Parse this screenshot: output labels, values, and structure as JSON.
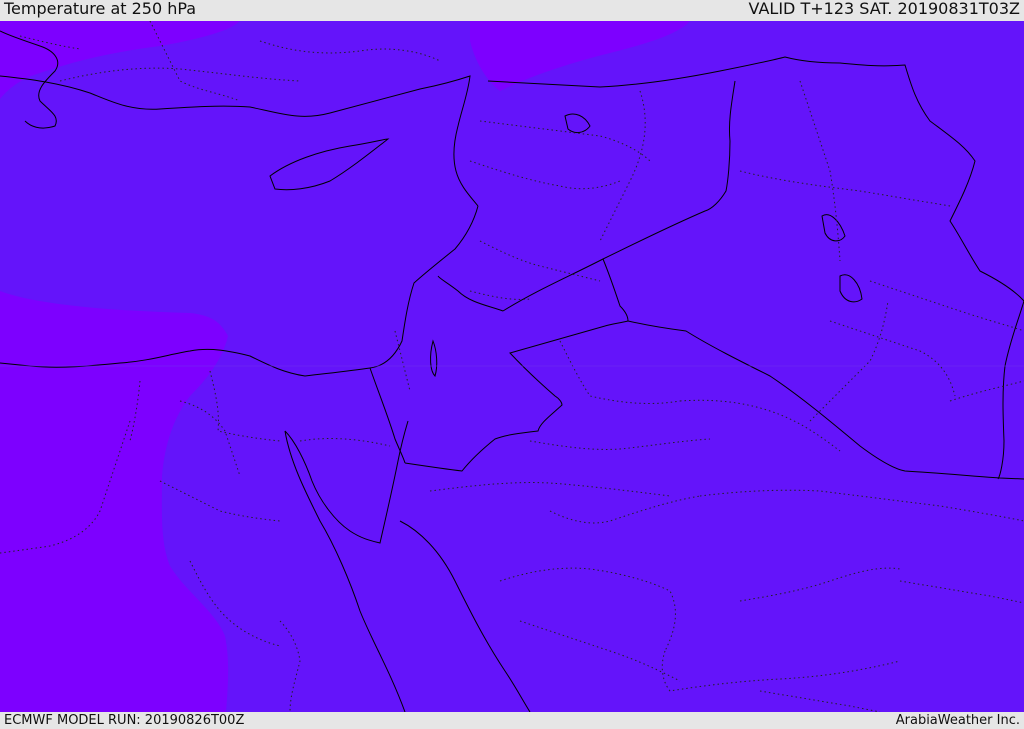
{
  "header": {
    "title": "Temperature at 250 hPa",
    "valid_time": "VALID T+123 SAT. 20190831T03Z"
  },
  "footer": {
    "model_run": "ECMWF MODEL RUN: 20190826T00Z",
    "credit": "ArabiaWeather Inc."
  },
  "map": {
    "fill_colors": {
      "main": "#6414fa",
      "warm_band": "#7d00ff",
      "coast_line": "#000000"
    }
  }
}
